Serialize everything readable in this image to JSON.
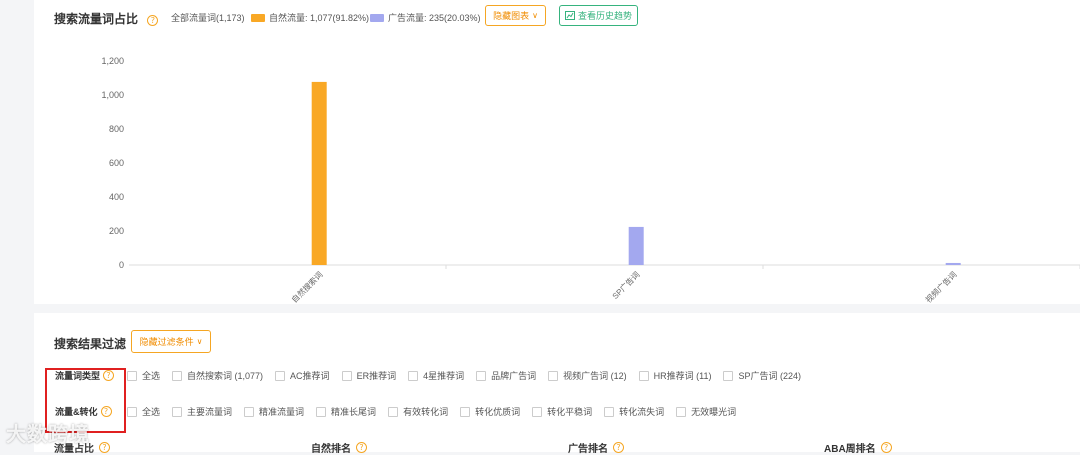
{
  "chart_section": {
    "title": "搜索流量词占比",
    "legend": {
      "all": "全部流量词(1,173)",
      "natural": "自然流量: 1,077(91.82%)",
      "ad": "广告流量: 235(20.03%)"
    },
    "hide_chart_label": "隐藏图表",
    "history_label": "查看历史趋势",
    "colors": {
      "natural": "#f9a825",
      "ad": "#a3a8ef"
    }
  },
  "chart_data": {
    "type": "bar",
    "categories": [
      "自然搜索词",
      "SP广告词",
      "视频广告词"
    ],
    "values": [
      1077,
      224,
      12
    ],
    "ylim": [
      0,
      1200
    ],
    "yticks": [
      "1,200",
      "1,000",
      "800",
      "600",
      "400",
      "200",
      "0"
    ],
    "grid": false,
    "colors": [
      "#f9a825",
      "#a3a8ef",
      "#a3a8ef"
    ]
  },
  "filter_section": {
    "title": "搜索结果过滤",
    "hide_filter_label": "隐藏过滤条件",
    "row1": {
      "label": "流量词类型",
      "options": [
        "全选",
        "自然搜索词 (1,077)",
        "AC推荐词",
        "ER推荐词",
        "4星推荐词",
        "品牌广告词",
        "视频广告词 (12)",
        "HR推荐词 (11)",
        "SP广告词 (224)"
      ]
    },
    "row2": {
      "label": "流量&转化",
      "options": [
        "全选",
        "主要流量词",
        "精准流量词",
        "精准长尾词",
        "有效转化词",
        "转化优质词",
        "转化平稳词",
        "转化流失词",
        "无效曝光词"
      ]
    },
    "columns": [
      "流量占比",
      "自然排名",
      "广告排名",
      "ABA周排名"
    ]
  },
  "watermark": "大数跨境"
}
